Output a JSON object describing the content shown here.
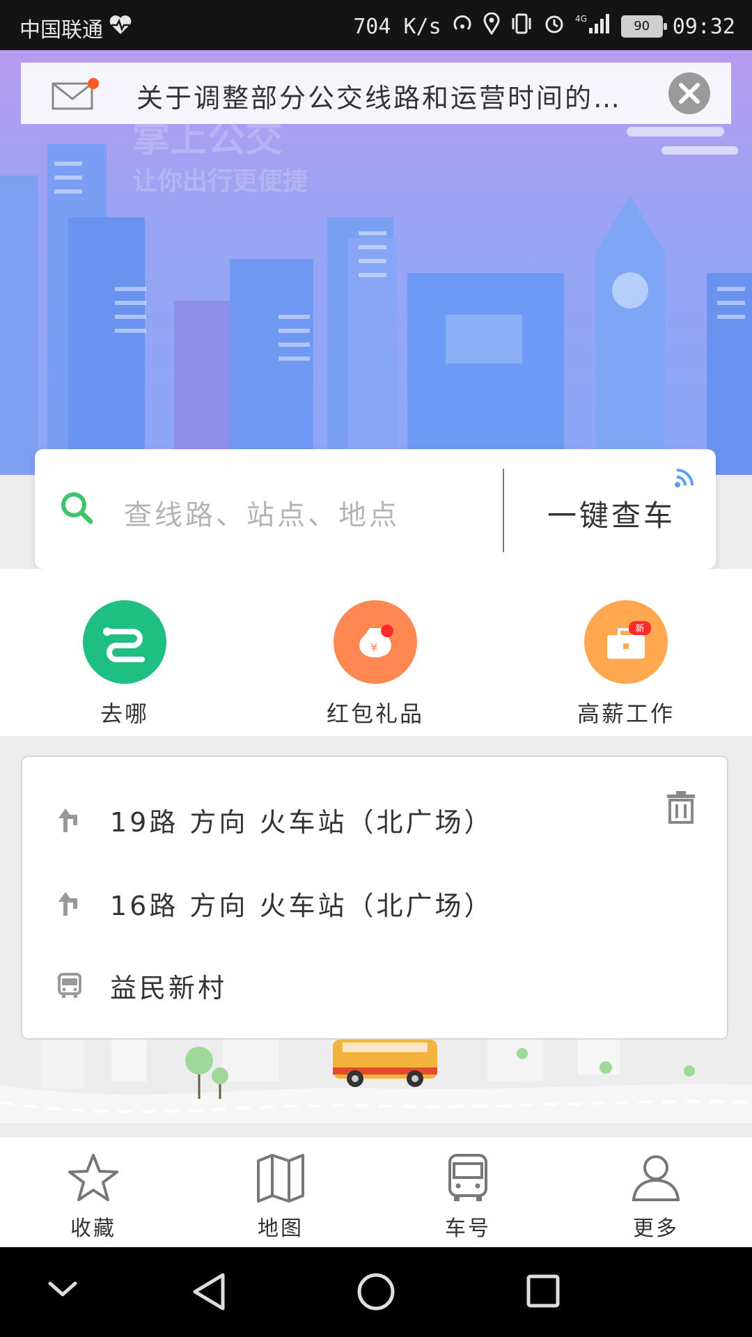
{
  "status_bar": {
    "carrier": "中国联通",
    "speed": "704 K/s",
    "network": "4G",
    "battery": "90",
    "time": "09:32"
  },
  "hero": {
    "title": "掌上公交",
    "subtitle": "让你出行更便捷"
  },
  "notice": {
    "text": "关于调整部分公交线路和运营时间的…",
    "icon": "mail-icon"
  },
  "search": {
    "placeholder": "查线路、站点、地点",
    "one_key_label": "一键查车"
  },
  "quick_actions": [
    {
      "label": "去哪",
      "color": "#1fbf83",
      "icon": "route-icon"
    },
    {
      "label": "红包礼品",
      "color": "#ff8752",
      "icon": "money-bag-icon"
    },
    {
      "label": "高薪工作",
      "color": "#ffa84f",
      "icon": "briefcase-icon",
      "badge": "新"
    }
  ],
  "history": [
    {
      "icon": "route-turn-icon",
      "text": "19路  方向  火车站（北广场）"
    },
    {
      "icon": "route-turn-icon",
      "text": "16路  方向  火车站（北广场）"
    },
    {
      "icon": "bus-stop-icon",
      "text": "益民新村"
    }
  ],
  "tabs": [
    {
      "label": "收藏",
      "icon": "star-icon"
    },
    {
      "label": "地图",
      "icon": "map-icon"
    },
    {
      "label": "车号",
      "icon": "bus-icon"
    },
    {
      "label": "更多",
      "icon": "user-icon"
    }
  ],
  "colors": {
    "accent_green": "#1fbf83",
    "hero_top": "#b79cf0",
    "hero_bottom": "#8ba7f6"
  }
}
